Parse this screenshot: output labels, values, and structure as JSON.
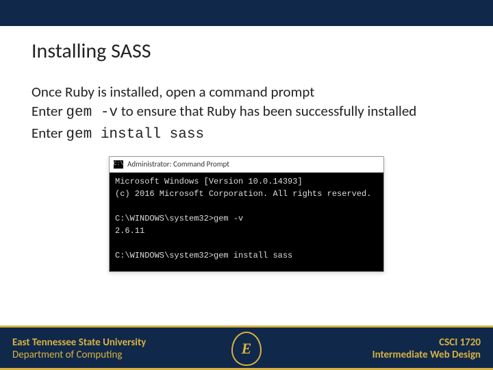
{
  "title": "Installing SASS",
  "body": {
    "line1": "Once Ruby is installed, open a command prompt",
    "line2a": "Enter ",
    "line2cmd": "gem -v",
    "line2b": " to ensure that Ruby has been successfully installed",
    "line3a": "Enter ",
    "line3cmd": "gem install sass"
  },
  "cmd": {
    "icon_text": "C:\\",
    "title": "Administrator: Command Prompt",
    "lines": "Microsoft Windows [Version 10.0.14393]\n(c) 2016 Microsoft Corporation. All rights reserved.\n\nC:\\WINDOWS\\system32>gem -v\n2.6.11\n\nC:\\WINDOWS\\system32>gem install sass"
  },
  "footer": {
    "left1": "East Tennessee State University",
    "left2": "Department of Computing",
    "logo": "E",
    "right1": "CSCI 1720",
    "right2": "Intermediate Web Design"
  }
}
